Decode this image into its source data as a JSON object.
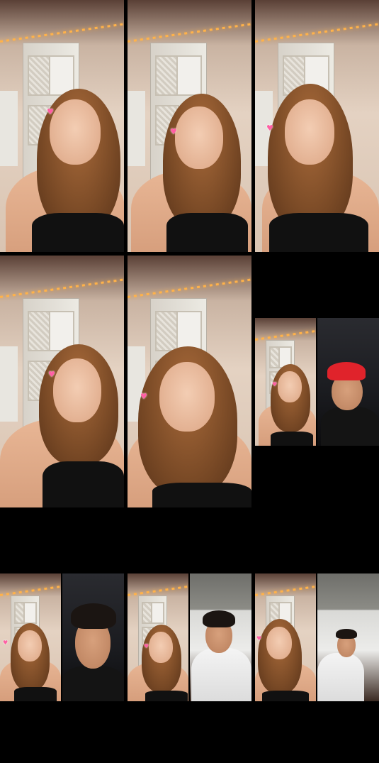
{
  "tiles": [
    {
      "id": "solo-1",
      "kind": "solo"
    },
    {
      "id": "solo-2",
      "kind": "solo"
    },
    {
      "id": "solo-3",
      "kind": "solo"
    },
    {
      "id": "solo-4",
      "kind": "solo"
    },
    {
      "id": "solo-5",
      "kind": "solo"
    },
    {
      "id": "duo-1",
      "kind": "duo",
      "guest_outfit": "red cap"
    },
    {
      "id": "duo-2",
      "kind": "duo",
      "guest_outfit": "dark room"
    },
    {
      "id": "duo-3",
      "kind": "duo",
      "guest_outfit": "white shirt"
    },
    {
      "id": "duo-4",
      "kind": "duo",
      "guest_outfit": "white shirt"
    }
  ],
  "icons": {
    "heart": "heart-sticker-icon"
  },
  "colors": {
    "background": "#000000",
    "heart": "#ff5fa4",
    "cap": "#e0232b"
  }
}
